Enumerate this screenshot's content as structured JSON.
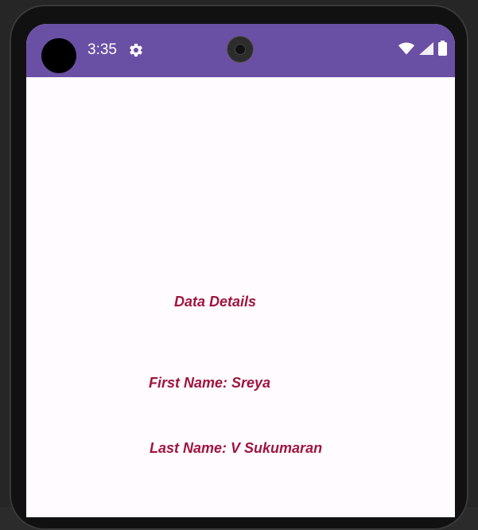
{
  "status_bar": {
    "time": "3:35",
    "background_color": "#6a50a4",
    "icons": [
      "settings-gear-icon",
      "wifi-icon",
      "signal-icon",
      "battery-icon"
    ]
  },
  "content": {
    "title": "Data Details",
    "first_name_line": "First Name: Sreya",
    "last_name_line": "Last Name: V Sukumaran",
    "text_color": "#a0153e"
  }
}
